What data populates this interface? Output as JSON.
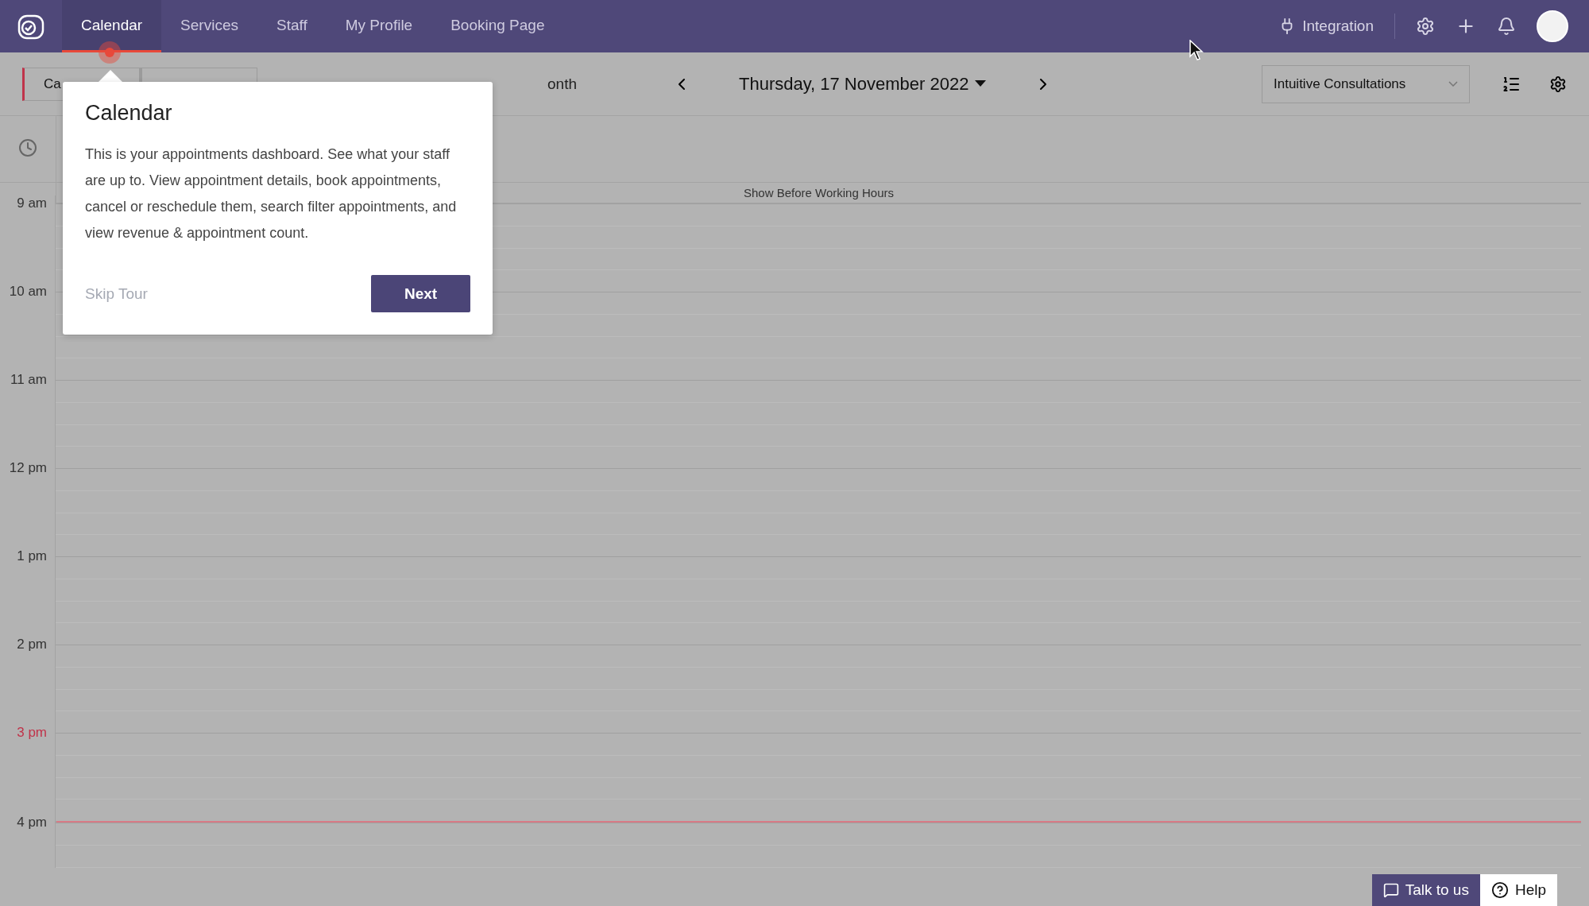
{
  "nav": {
    "tabs": [
      {
        "label": "Calendar",
        "selected": true
      },
      {
        "label": "Services",
        "selected": false
      },
      {
        "label": "Staff",
        "selected": false
      },
      {
        "label": "My Profile",
        "selected": false
      },
      {
        "label": "Booking Page",
        "selected": false
      }
    ],
    "integration": "Integration"
  },
  "toolbar": {
    "view_tabs": [
      {
        "label": "Ca",
        "selected": true
      },
      {
        "selected": false
      }
    ],
    "range_label": "onth",
    "date": "Thursday, 17 November 2022",
    "service_select": "Intuitive Consultations"
  },
  "calendar": {
    "before_hours": "Show Before Working Hours",
    "hours": [
      {
        "label": "9 am",
        "current": false
      },
      {
        "label": "10 am",
        "current": false
      },
      {
        "label": "11 am",
        "current": false
      },
      {
        "label": "12 pm",
        "current": false
      },
      {
        "label": "1 pm",
        "current": false
      },
      {
        "label": "2 pm",
        "current": false
      },
      {
        "label": "3 pm",
        "current": true
      },
      {
        "label": "4 pm",
        "current": false
      }
    ]
  },
  "tour": {
    "title": "Calendar",
    "body": "This is your appointments dashboard. See what your staff are up to. View appointment details, book appointments, cancel or reschedule them, search filter appointments, and view revenue & appointment count.",
    "skip": "Skip Tour",
    "next": "Next"
  },
  "footer": {
    "talk": "Talk to us",
    "help": "Help"
  }
}
